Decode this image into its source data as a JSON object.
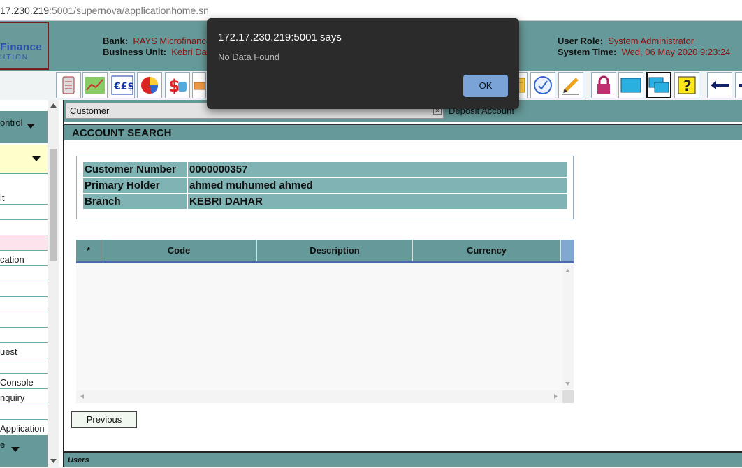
{
  "browser": {
    "url_prefix": "17.230.219",
    "url_port": ":5001",
    "url_path": "/supernova/applicationhome.sn"
  },
  "header": {
    "logo_line1": "Finance",
    "logo_line2": "UTION",
    "bank_label": "Bank:",
    "bank_value": "RAYS Microfinance",
    "bu_label": "Business Unit:",
    "bu_value": "Kebri Da",
    "role_label": "User Role:",
    "role_value": "System Administrator",
    "time_label": "System Time:",
    "time_value": "Wed, 06 May 2020 9:23:24"
  },
  "toolbar": {
    "icons": [
      "report-icon",
      "chart-icon",
      "currency-icon",
      "pie-chart-icon",
      "dollar-hand-icon",
      "folder-icon",
      "calendar-icon",
      "clock-icon",
      "pencil-icon",
      "lock-icon",
      "window-icon",
      "windows-icon",
      "help-icon",
      "back-icon"
    ],
    "help_glyph": "?",
    "back_glyph": "⟵"
  },
  "sidebar": {
    "items": [
      "ontrol",
      "",
      "it",
      "",
      "",
      "cation",
      "",
      "",
      "",
      "",
      "uest",
      "",
      " Console",
      "nquiry",
      "",
      " Application",
      "e"
    ]
  },
  "main": {
    "customer_field": "Customer",
    "deposit_label": "Deposit Account",
    "title": "ACCOUNT SEARCH",
    "info": {
      "rows": [
        {
          "label": "Customer Number",
          "value": "0000000357"
        },
        {
          "label": "Primary Holder",
          "value": "ahmed muhumed ahmed"
        },
        {
          "label": "Branch",
          "value": "KEBRI DAHAR"
        }
      ]
    },
    "grid": {
      "columns": [
        "*",
        "Code",
        "Description",
        "Currency"
      ]
    },
    "previous_label": "Previous",
    "footer_label": "Users"
  },
  "dialog": {
    "title": "172.17.230.219:5001 says",
    "message": "No Data Found",
    "ok_label": "OK"
  }
}
